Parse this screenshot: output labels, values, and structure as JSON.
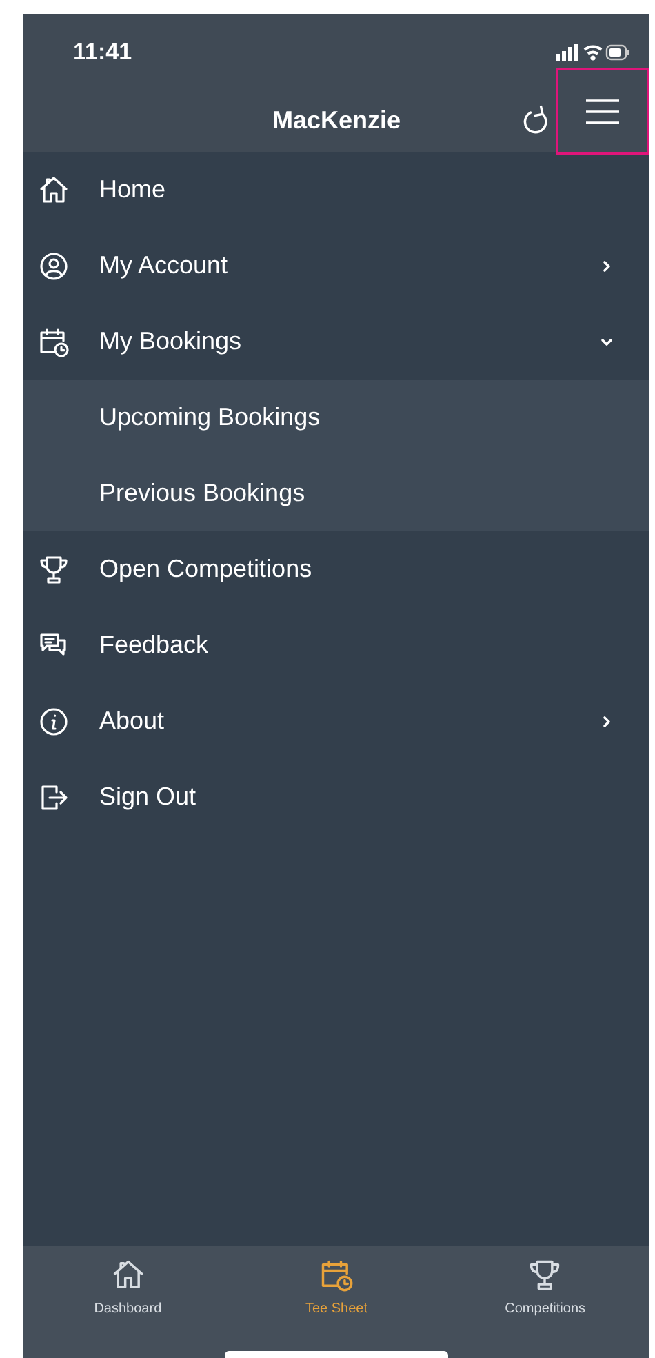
{
  "status_bar": {
    "time": "11:41"
  },
  "header": {
    "title": "MacKenzie",
    "menu_button": {
      "highlighted": true
    }
  },
  "menu": [
    {
      "label": "Home"
    },
    {
      "label": "My Account",
      "expanded": false
    },
    {
      "label": "My Bookings",
      "expanded": true,
      "children": [
        {
          "label": "Upcoming Bookings"
        },
        {
          "label": "Previous Bookings"
        }
      ]
    },
    {
      "label": "Open Competitions"
    },
    {
      "label": "Feedback"
    },
    {
      "label": "About",
      "expanded": false
    },
    {
      "label": "Sign Out"
    }
  ],
  "tab_bar": [
    {
      "label": "Dashboard",
      "selected": false
    },
    {
      "label": "Tee Sheet",
      "selected": true
    },
    {
      "label": "Competitions",
      "selected": false
    }
  ]
}
